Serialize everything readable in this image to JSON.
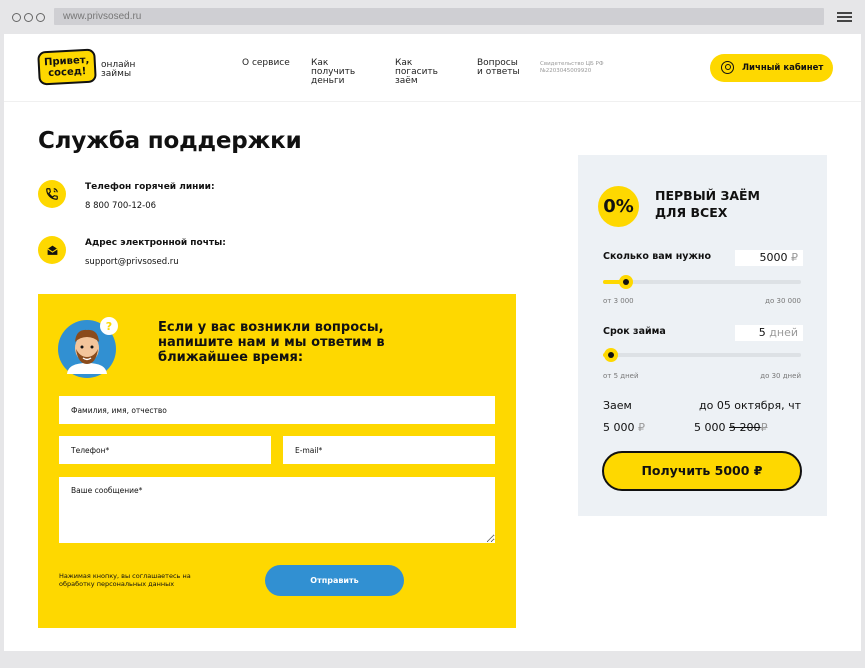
{
  "browser": {
    "url": "www.privsosed.ru"
  },
  "header": {
    "logo_text": "Привет, сосед!",
    "logo_sub": "онлайн займы",
    "nav": [
      "О сервисе",
      "Как получить деньги",
      "Как погасить заём",
      "Вопросы и ответы"
    ],
    "cert": "Свидетельство ЦБ РФ №2203045009920",
    "cabinet_label": "Личный кабинет"
  },
  "page_title": "Служба поддержки",
  "contacts": {
    "phone_label": "Телефон горячей линии:",
    "phone_value": "8 800 700-12-06",
    "email_label": "Адрес электронной почты:",
    "email_value": "support@privsosed.ru"
  },
  "form": {
    "title": "Если у вас возникли вопросы, напишите нам и мы ответим в ближайшее время:",
    "name_placeholder": "Фамилия, имя, отчество",
    "phone_placeholder": "Телефон*",
    "email_placeholder": "E-mail*",
    "message_placeholder": "Ваше сообщение*",
    "agree_text": "Нажимая кнопку, вы соглашаетесь на обработку персональных данных",
    "submit_label": "Отправить"
  },
  "loan": {
    "badge": "0%",
    "offer_title": "ПЕРВЫЙ ЗАЁМ ДЛЯ ВСЕХ",
    "amount_label": "Сколько вам нужно",
    "amount_value": "5000",
    "amount_unit": "₽",
    "amount_min": "от 3 000",
    "amount_max": "до 30 000",
    "amount_fraction": 0.074,
    "term_label": "Срок займа",
    "term_value": "5",
    "term_unit": "дней",
    "term_min": "от 5 дней",
    "term_max": "до 30 дней",
    "term_fraction": 0.0,
    "loan_label": "Заем",
    "due_label": "до 05 октября, чт",
    "loan_sum": "5 000",
    "return_sum": "5 000",
    "return_old": "5 200",
    "currency": "₽",
    "get_button": "Получить 5000 ₽"
  },
  "colors": {
    "yellow": "#fed800",
    "blue": "#3190d2",
    "card_bg": "#edf1f5"
  }
}
